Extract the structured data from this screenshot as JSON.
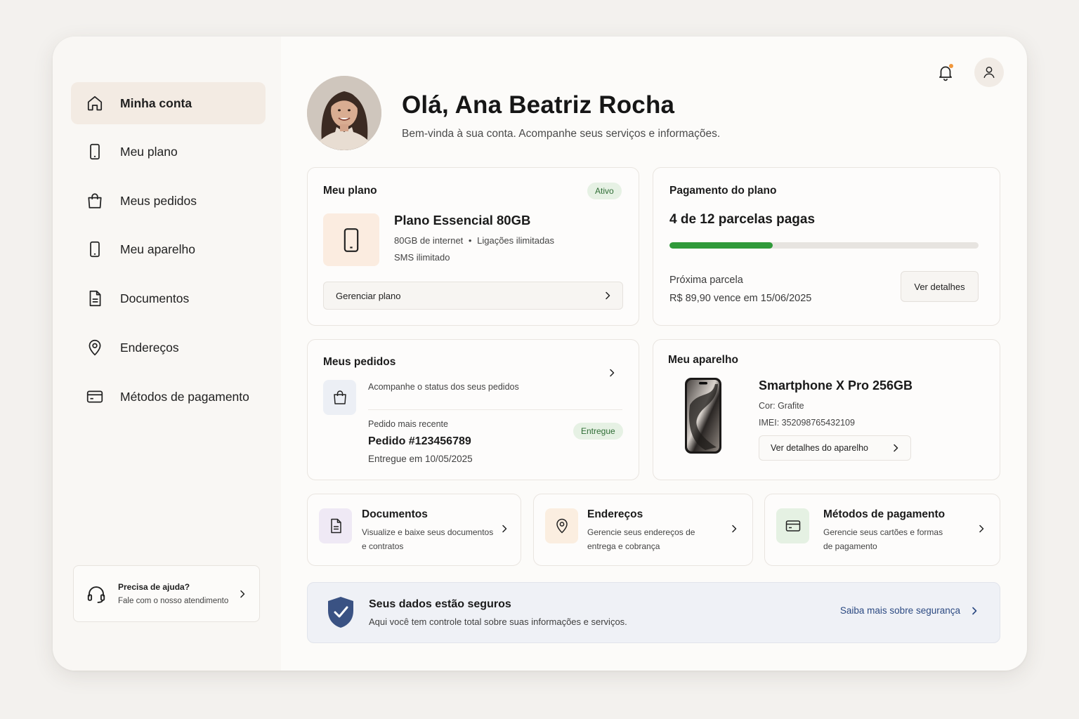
{
  "sidebar": {
    "items": [
      {
        "label": "Minha conta",
        "icon": "home-icon"
      },
      {
        "label": "Meu plano",
        "icon": "phone-icon"
      },
      {
        "label": "Meus pedidos",
        "icon": "shopping-bag-icon"
      },
      {
        "label": "Meu aparelho",
        "icon": "phone-icon"
      },
      {
        "label": "Documentos",
        "icon": "document-icon"
      },
      {
        "label": "Endereços",
        "icon": "map-pin-icon"
      },
      {
        "label": "Métodos de pagamento",
        "icon": "credit-card-icon"
      }
    ],
    "help": {
      "title": "Precisa de ajuda?",
      "subtitle": "Fale com o nosso atendimento"
    }
  },
  "header": {
    "greeting": "Olá, Ana Beatriz Rocha",
    "subtitle": "Bem-vinda à sua conta. Acompanhe seus serviços e informações.",
    "notification_dot_color": "#f0963a"
  },
  "plan": {
    "title": "Meu plano",
    "status": "Ativo",
    "name": "Plano Essencial 80GB",
    "features_line1_a": "80GB de internet",
    "features_line1_b": "Ligações ilimitadas",
    "features_line2": "SMS ilimitado",
    "manage_label": "Gerenciar plano"
  },
  "payment": {
    "title": "Pagamento do plano",
    "summary": "4 de 12 parcelas pagas",
    "paid": 4,
    "total": 12,
    "next_label": "Próxima parcela",
    "next_value": "R$ 89,90 vence em 15/06/2025",
    "details_button": "Ver detalhes",
    "progress_color": "#2f9a3a"
  },
  "orders": {
    "title": "Meus pedidos",
    "description": "Acompanhe o status dos seus pedidos",
    "recent_label": "Pedido mais recente",
    "order_number": "Pedido #123456789",
    "delivered_on": "Entregue em 10/05/2025",
    "status": "Entregue"
  },
  "device": {
    "title": "Meu aparelho",
    "name": "Smartphone X Pro 256GB",
    "color": "Cor: Grafite",
    "imei": "IMEI: 352098765432109",
    "details_button": "Ver detalhes do aparelho"
  },
  "quick_links": [
    {
      "title": "Documentos",
      "desc1": "Visualize e baixe seus documentos",
      "desc2": "e contratos",
      "icon": "document-icon",
      "tile_color": "#efe9f5"
    },
    {
      "title": "Endereços",
      "desc1": "Gerencie seus endereços de",
      "desc2": "entrega e cobrança",
      "icon": "map-pin-icon",
      "tile_color": "#fbeee0"
    },
    {
      "title": "Métodos de pagamento",
      "desc1": "Gerencie seus cartões e formas",
      "desc2": "de pagamento",
      "icon": "credit-card-icon",
      "tile_color": "#e5f1e3"
    }
  ],
  "security": {
    "title": "Seus dados estão seguros",
    "subtitle": "Aqui você tem controle total sobre suas informações e serviços.",
    "link": "Saiba mais sobre segurança",
    "shield_color": "#3a5283"
  }
}
